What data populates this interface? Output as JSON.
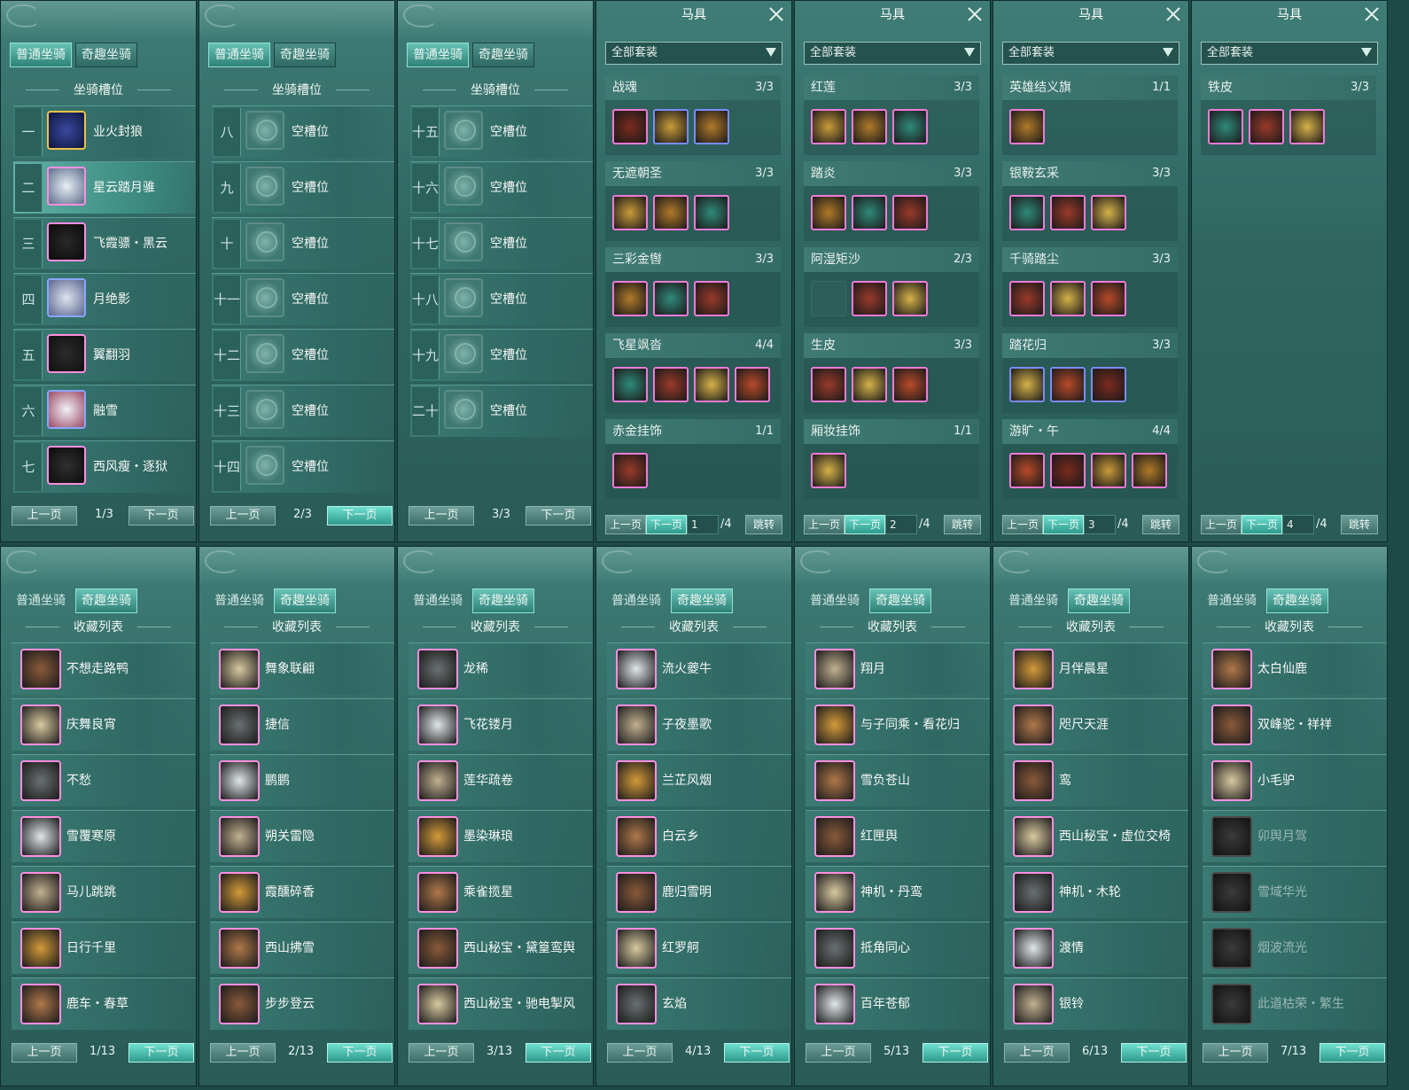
{
  "common": {
    "tab_normal": "普通坐骑",
    "tab_fun": "奇趣坐骑",
    "slots_title": "坐骑槽位",
    "collection_title": "收藏列表",
    "prev": "上一页",
    "next": "下一页",
    "tack_title": "马具",
    "all_sets": "全部套装",
    "jump": "跳转"
  },
  "slot_pages": [
    {
      "page": "1/3",
      "rows": [
        {
          "idx": "一",
          "name": "业火封狼"
        },
        {
          "idx": "二",
          "name": "星云踏月骓"
        },
        {
          "idx": "三",
          "name": "飞霞骠・黑云"
        },
        {
          "idx": "四",
          "name": "月绝影"
        },
        {
          "idx": "五",
          "name": "翼翻羽"
        },
        {
          "idx": "六",
          "name": "融雪"
        },
        {
          "idx": "七",
          "name": "西风瘦・逐狱"
        }
      ]
    },
    {
      "page": "2/3",
      "rows": [
        {
          "idx": "八",
          "name": "空槽位"
        },
        {
          "idx": "九",
          "name": "空槽位"
        },
        {
          "idx": "十",
          "name": "空槽位"
        },
        {
          "idx": "十一",
          "name": "空槽位"
        },
        {
          "idx": "十二",
          "name": "空槽位"
        },
        {
          "idx": "十三",
          "name": "空槽位"
        },
        {
          "idx": "十四",
          "name": "空槽位"
        }
      ]
    },
    {
      "page": "3/3",
      "rows": [
        {
          "idx": "十五",
          "name": "空槽位"
        },
        {
          "idx": "十六",
          "name": "空槽位"
        },
        {
          "idx": "十七",
          "name": "空槽位"
        },
        {
          "idx": "十八",
          "name": "空槽位"
        },
        {
          "idx": "十九",
          "name": "空槽位"
        },
        {
          "idx": "二十",
          "name": "空槽位"
        }
      ]
    }
  ],
  "tack_pages": [
    {
      "page": "1",
      "total": "/4",
      "sets": [
        {
          "name": "战魂",
          "count": "3/3"
        },
        {
          "name": "无遮朝圣",
          "count": "3/3"
        },
        {
          "name": "三彩金辔",
          "count": "3/3"
        },
        {
          "name": "飞星飒沓",
          "count": "4/4"
        },
        {
          "name": "赤金挂饰",
          "count": "1/1"
        }
      ]
    },
    {
      "page": "2",
      "total": "/4",
      "sets": [
        {
          "name": "红莲",
          "count": "3/3"
        },
        {
          "name": "踏炎",
          "count": "3/3"
        },
        {
          "name": "阿湿矩沙",
          "count": "2/3"
        },
        {
          "name": "生皮",
          "count": "3/3"
        },
        {
          "name": "厢妆挂饰",
          "count": "1/1"
        }
      ]
    },
    {
      "page": "3",
      "total": "/4",
      "sets": [
        {
          "name": "英雄结义旗",
          "count": "1/1"
        },
        {
          "name": "银鞍玄采",
          "count": "3/3"
        },
        {
          "name": "千骑踏尘",
          "count": "3/3"
        },
        {
          "name": "踏花归",
          "count": "3/3"
        },
        {
          "name": "游旷・午",
          "count": "4/4"
        }
      ]
    },
    {
      "page": "4",
      "total": "/4",
      "sets": [
        {
          "name": "铁皮",
          "count": "3/3"
        }
      ]
    }
  ],
  "collection_pages": [
    {
      "page": "1/13",
      "items": [
        "不想走路鸭",
        "庆舞良宵",
        "不愁",
        "雪覆寒原",
        "马儿跳跳",
        "日行千里",
        "鹿车・春草"
      ]
    },
    {
      "page": "2/13",
      "items": [
        "舞象联翩",
        "捷信",
        "鹏鹏",
        "朔关雷隐",
        "霞醺碎香",
        "西山拂雪",
        "步步登云"
      ]
    },
    {
      "page": "3/13",
      "items": [
        "龙稀",
        "飞花镂月",
        "莲华疏卷",
        "墨染琳琅",
        "乘雀揽星",
        "西山秘宝・黛篁鸾舆",
        "西山秘宝・驰电掣风"
      ]
    },
    {
      "page": "4/13",
      "items": [
        "流火夔牛",
        "子夜墨歌",
        "兰芷风烟",
        "白云乡",
        "鹿归雪明",
        "红罗舸",
        "玄焰"
      ]
    },
    {
      "page": "5/13",
      "items": [
        "翔月",
        "与子同乘・看花归",
        "雪负苍山",
        "红匣舆",
        "神机・丹鸾",
        "抵角同心",
        "百年苍郁"
      ]
    },
    {
      "page": "6/13",
      "items": [
        "月伴晨星",
        "咫尺天涯",
        "鸾",
        "西山秘宝・虚位交椅",
        "神机・木轮",
        "渡情",
        "银铃"
      ]
    },
    {
      "page": "7/13",
      "items": [
        "太白仙鹿",
        "双峰驼・祥祥",
        "小毛驴",
        "卯舆月驾",
        "雪域华光",
        "烟波流光",
        "此道枯荣・繁生"
      ]
    }
  ]
}
